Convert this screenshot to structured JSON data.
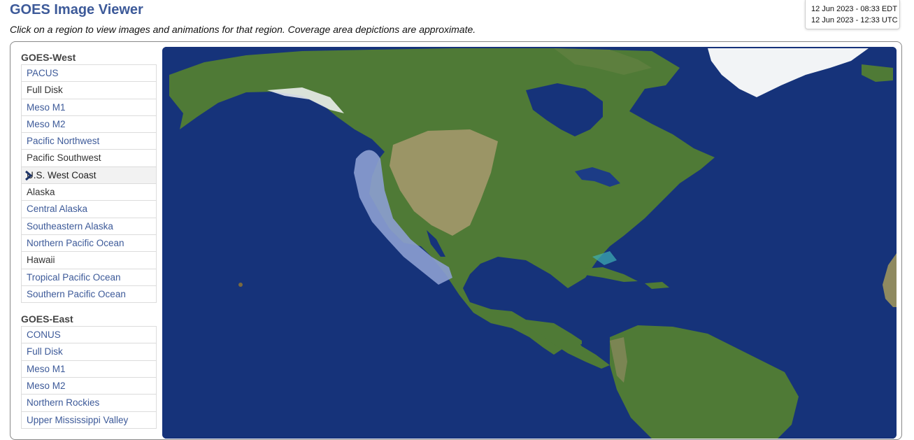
{
  "header": {
    "title": "GOES Image Viewer",
    "subtitle": "Click on a region to view images and animations for that region. Coverage area depictions are approximate.",
    "time_local": "12 Jun 2023 - 08:33 EDT",
    "time_utc": "12 Jun 2023 - 12:33 UTC"
  },
  "sidebar": {
    "goes_west": {
      "heading": "GOES-West",
      "items": [
        {
          "label": "PACUS"
        },
        {
          "label": "Full Disk"
        },
        {
          "label": "Meso M1"
        },
        {
          "label": "Meso M2"
        },
        {
          "label": "Pacific Northwest"
        },
        {
          "label": "Pacific Southwest"
        },
        {
          "label": "U.S. West Coast"
        },
        {
          "label": "Alaska"
        },
        {
          "label": "Central Alaska"
        },
        {
          "label": "Southeastern Alaska"
        },
        {
          "label": "Northern Pacific Ocean"
        },
        {
          "label": "Hawaii"
        },
        {
          "label": "Tropical Pacific Ocean"
        },
        {
          "label": "Southern Pacific Ocean"
        }
      ]
    },
    "goes_east": {
      "heading": "GOES-East",
      "items": [
        {
          "label": "CONUS"
        },
        {
          "label": "Full Disk"
        },
        {
          "label": "Meso M1"
        },
        {
          "label": "Meso M2"
        },
        {
          "label": "Northern Rockies"
        },
        {
          "label": "Upper Mississippi Valley"
        }
      ]
    }
  },
  "map": {
    "selected_region": "U.S. West Coast",
    "colors": {
      "ocean": "#16337a",
      "land": "#4f7a36",
      "desert": "#a89a6e",
      "ice": "#f2f4f6",
      "highlight": "#8c9fd2",
      "link": "#3d5a99"
    }
  }
}
